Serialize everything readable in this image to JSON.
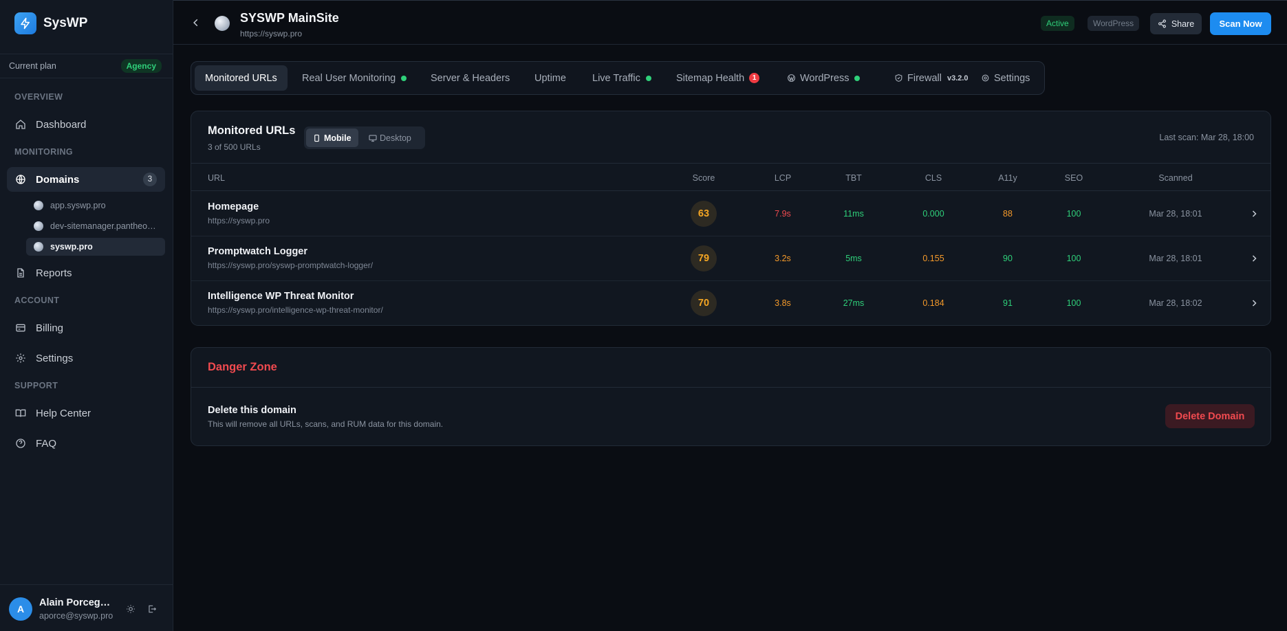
{
  "brand": {
    "name": "SysWP"
  },
  "plan": {
    "label": "Current plan",
    "badge": "Agency"
  },
  "sidebar": {
    "sections": {
      "overview": "OVERVIEW",
      "monitoring": "MONITORING",
      "account": "ACCOUNT",
      "support": "SUPPORT"
    },
    "items": {
      "dashboard": "Dashboard",
      "domains": "Domains",
      "domains_count": "3",
      "reports": "Reports",
      "billing": "Billing",
      "settings": "Settings",
      "help": "Help Center",
      "faq": "FAQ"
    },
    "domains": [
      "app.syswp.pro",
      "dev-sitemanager.pantheonsite.io",
      "syswp.pro"
    ]
  },
  "user": {
    "initial": "A",
    "name": "Alain Porceguerre",
    "email": "aporce@syswp.pro"
  },
  "header": {
    "title": "SYSWP MainSite",
    "url": "https://syswp.pro",
    "badge_active": "Active",
    "badge_platform": "WordPress",
    "share_label": "Share",
    "scan_label": "Scan Now"
  },
  "tabs": {
    "monitored": "Monitored URLs",
    "rum": "Real User Monitoring",
    "server": "Server & Headers",
    "uptime": "Uptime",
    "traffic": "Live Traffic",
    "sitemap": "Sitemap Health",
    "sitemap_count": "1",
    "wordpress": "WordPress",
    "firewall": "Firewall",
    "firewall_version": "v3.2.0",
    "settings": "Settings"
  },
  "monitored": {
    "title": "Monitored URLs",
    "subtitle": "3 of 500 URLs",
    "toggle_mobile": "Mobile",
    "toggle_desktop": "Desktop",
    "last_scan": "Last scan: Mar 28, 18:00",
    "columns": {
      "url": "URL",
      "score": "Score",
      "lcp": "LCP",
      "tbt": "TBT",
      "cls": "CLS",
      "a11y": "A11y",
      "seo": "SEO",
      "scanned": "Scanned"
    },
    "rows": [
      {
        "name": "Homepage",
        "url": "https://syswp.pro",
        "score": "63",
        "lcp": "7.9s",
        "tbt": "11ms",
        "cls": "0.000",
        "a11y": "88",
        "seo": "100",
        "scanned": "Mar 28, 18:01"
      },
      {
        "name": "Promptwatch Logger",
        "url": "https://syswp.pro/syswp-promptwatch-logger/",
        "score": "79",
        "lcp": "3.2s",
        "tbt": "5ms",
        "cls": "0.155",
        "a11y": "90",
        "seo": "100",
        "scanned": "Mar 28, 18:01"
      },
      {
        "name": "Intelligence WP Threat Monitor",
        "url": "https://syswp.pro/intelligence-wp-threat-monitor/",
        "score": "70",
        "lcp": "3.8s",
        "tbt": "27ms",
        "cls": "0.184",
        "a11y": "91",
        "seo": "100",
        "scanned": "Mar 28, 18:02"
      }
    ]
  },
  "danger": {
    "title": "Danger Zone",
    "heading": "Delete this domain",
    "description": "This will remove all URLs, scans, and RUM data for this domain.",
    "button": "Delete Domain"
  },
  "colors": {
    "accent": "#1d8cf0",
    "success": "#2fd07a",
    "warning": "#f59a2a",
    "danger": "#f04a4f"
  }
}
